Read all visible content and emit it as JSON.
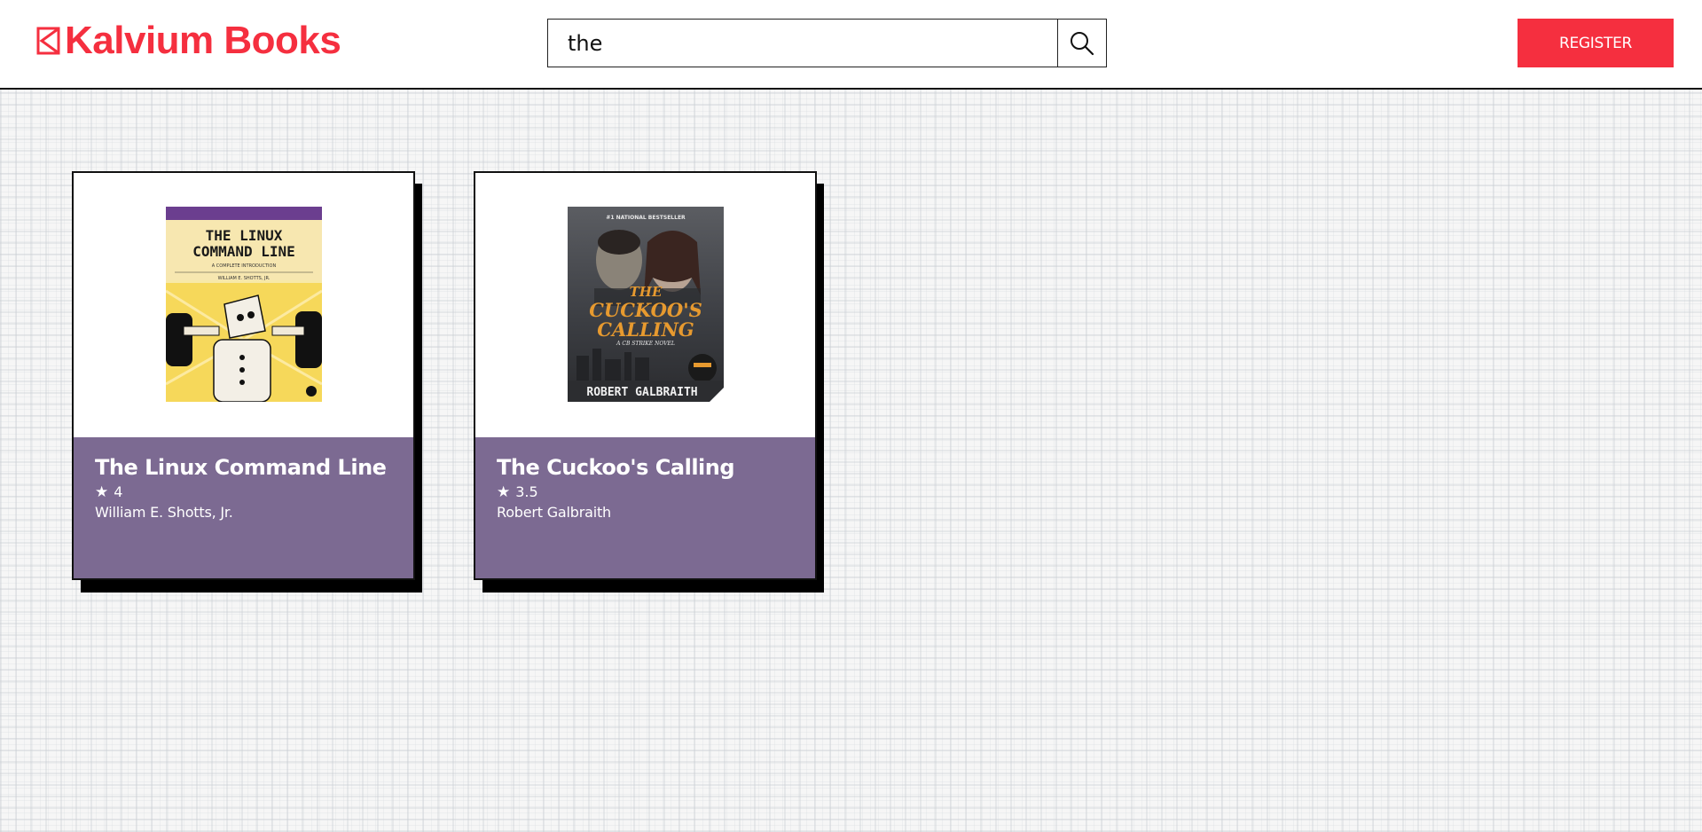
{
  "header": {
    "logo_text": "Kalvium Books",
    "logo_icon": "book-outline-icon",
    "search_value": "the",
    "search_icon": "magnifier-icon",
    "register_label": "REGISTER"
  },
  "colors": {
    "brand": "#f52f3f",
    "card_info_bg": "#7c6a92",
    "card_shadow": "#000000"
  },
  "books": [
    {
      "title": "The Linux Command Line",
      "rating": "4",
      "author": "William E. Shotts, Jr.",
      "cover": {
        "title_line1": "THE LINUX",
        "title_line2": "COMMAND LINE",
        "subtitle": "A COMPLETE INTRODUCTION",
        "author": "WILLIAM E. SHOTTS, JR."
      }
    },
    {
      "title": "The Cuckoo's Calling",
      "rating": "3.5",
      "author": "Robert Galbraith",
      "cover": {
        "tagline": "#1 NATIONAL BESTSELLER",
        "title_line1": "THE",
        "title_line2": "CUCKOO'S",
        "title_line3": "CALLING",
        "subtitle": "A CB STRIKE NOVEL",
        "author": "ROBERT GALBRAITH"
      }
    }
  ]
}
